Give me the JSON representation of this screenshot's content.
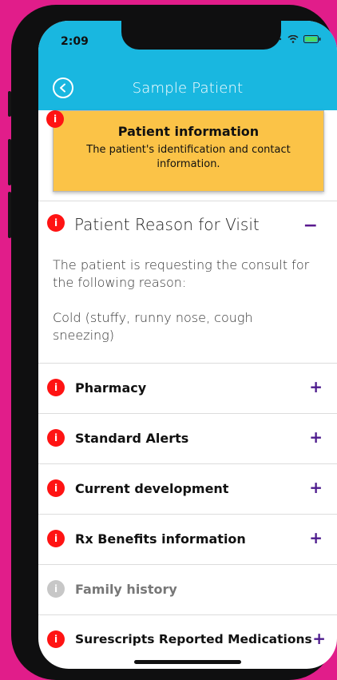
{
  "status": {
    "time": "2:09"
  },
  "nav": {
    "title": "Sample Patient"
  },
  "info_card": {
    "badge": "i",
    "title": "Patient information",
    "description": "The patient's identification and contact information."
  },
  "expanded_section": {
    "badge": "i",
    "title": "Patient Reason for Visit",
    "toggle": "−",
    "body": "The patient is requesting the consult for the following reason:",
    "reason": "Cold (stuffy, runny nose, cough sneezing)"
  },
  "sections": [
    {
      "badge": "i",
      "label": "Pharmacy",
      "toggle": "+"
    },
    {
      "badge": "i",
      "label": "Standard Alerts",
      "toggle": "+"
    },
    {
      "badge": "i",
      "label": "Current development",
      "toggle": "+"
    },
    {
      "badge": "i",
      "label": "Rx Benefits information",
      "toggle": "+"
    },
    {
      "badge": "i",
      "label": "Family history",
      "toggle": ""
    },
    {
      "badge": "i",
      "label": "Surescripts Reported Medications",
      "toggle": "+"
    }
  ],
  "colors": {
    "background": "#e11d8a",
    "header": "#19b7e0",
    "card": "#fbc347",
    "badge": "#ff1313",
    "badge_disabled": "#c7c7c7",
    "accent": "#4d1b8d"
  },
  "icons": {
    "back": "back-arrow-icon",
    "info": "info-icon"
  }
}
